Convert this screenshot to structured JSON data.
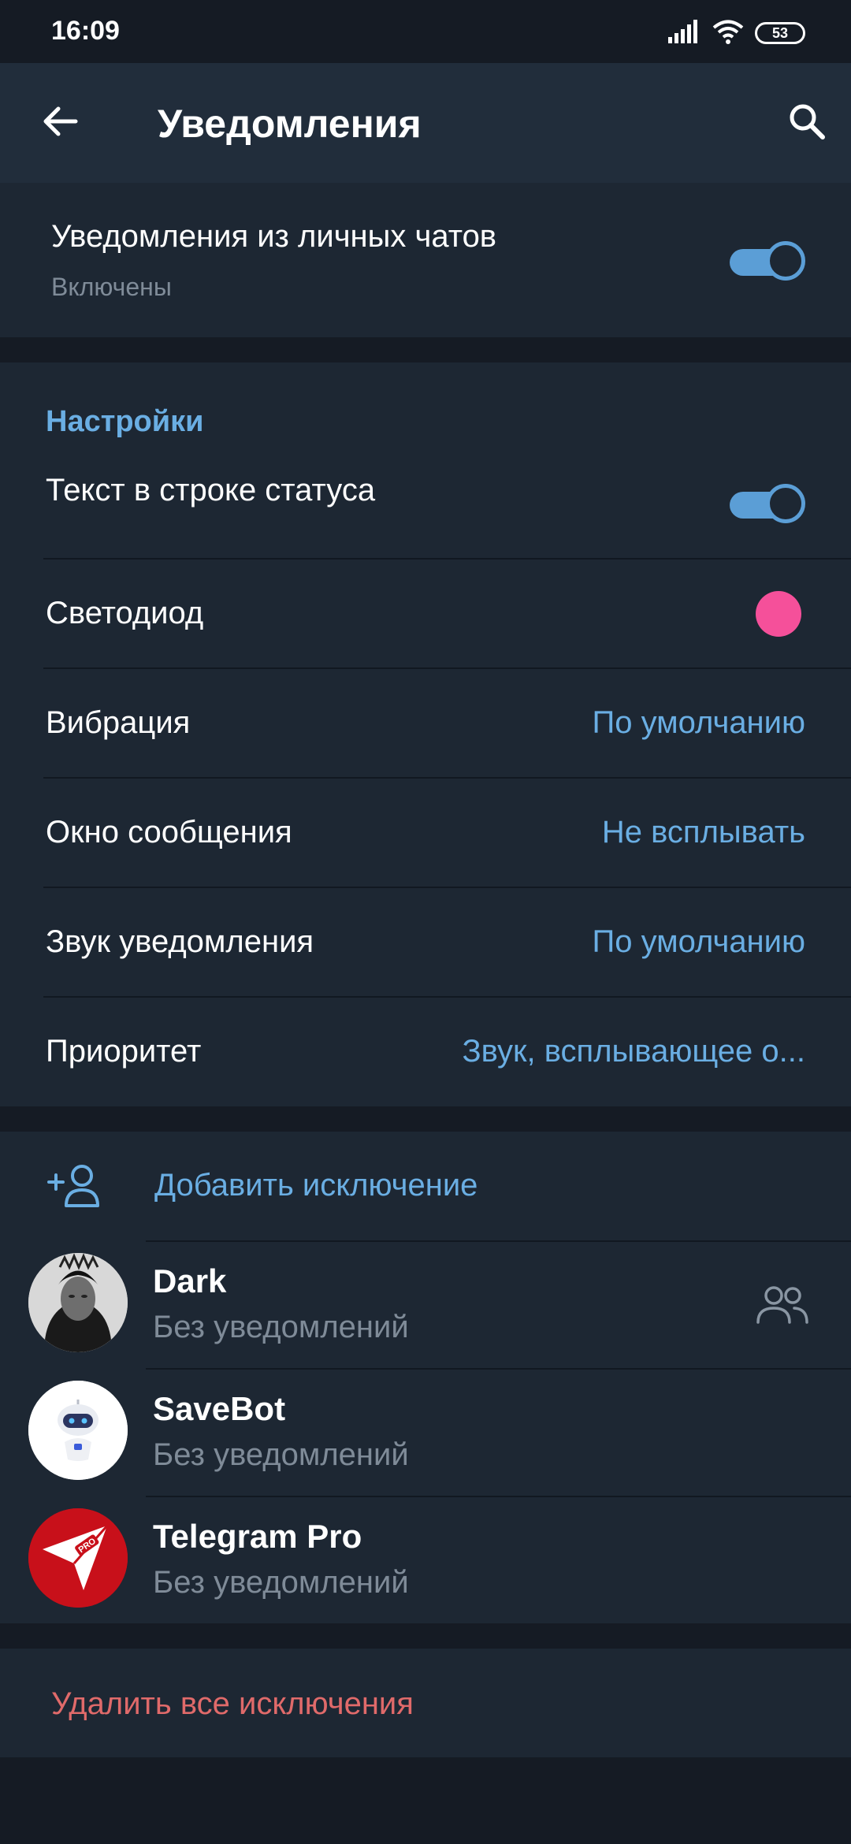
{
  "status_bar": {
    "time": "16:09",
    "battery": "53",
    "icons": [
      "signal-icon",
      "wifi-icon",
      "battery-icon"
    ]
  },
  "appbar": {
    "title": "Уведомления",
    "back_icon": "arrow-left-icon",
    "search_icon": "search-icon"
  },
  "private_chats": {
    "title": "Уведомления из личных чатов",
    "subtitle": "Включены",
    "enabled": true
  },
  "settings": {
    "header": "Настройки",
    "items": [
      {
        "label": "Текст в строке статуса",
        "type": "toggle",
        "enabled": true
      },
      {
        "label": "Светодиод",
        "type": "color",
        "color": "#f5509a"
      },
      {
        "label": "Вибрация",
        "type": "value",
        "value": "По умолчанию"
      },
      {
        "label": "Окно сообщения",
        "type": "value",
        "value": "Не всплывать"
      },
      {
        "label": "Звук уведомления",
        "type": "value",
        "value": "По умолчанию"
      },
      {
        "label": "Приоритет",
        "type": "value",
        "value": "Звук, всплывающее о..."
      }
    ]
  },
  "exceptions": {
    "add_label": "Добавить исключение",
    "add_icon": "add-user-icon",
    "items": [
      {
        "name": "Dark",
        "status": "Без уведомлений",
        "group": true
      },
      {
        "name": "SaveBot",
        "status": "Без уведомлений",
        "group": false
      },
      {
        "name": "Telegram Pro",
        "status": "Без уведомлений",
        "group": false
      }
    ],
    "telegram_pro_badge": "PRO"
  },
  "delete_all": {
    "label": "Удалить все исключения"
  },
  "colors": {
    "background": "#151b24",
    "surface": "#1d2733",
    "appbar": "#212d3b",
    "accent": "#6aaee3",
    "danger": "#e06a6a",
    "led": "#f5509a"
  }
}
